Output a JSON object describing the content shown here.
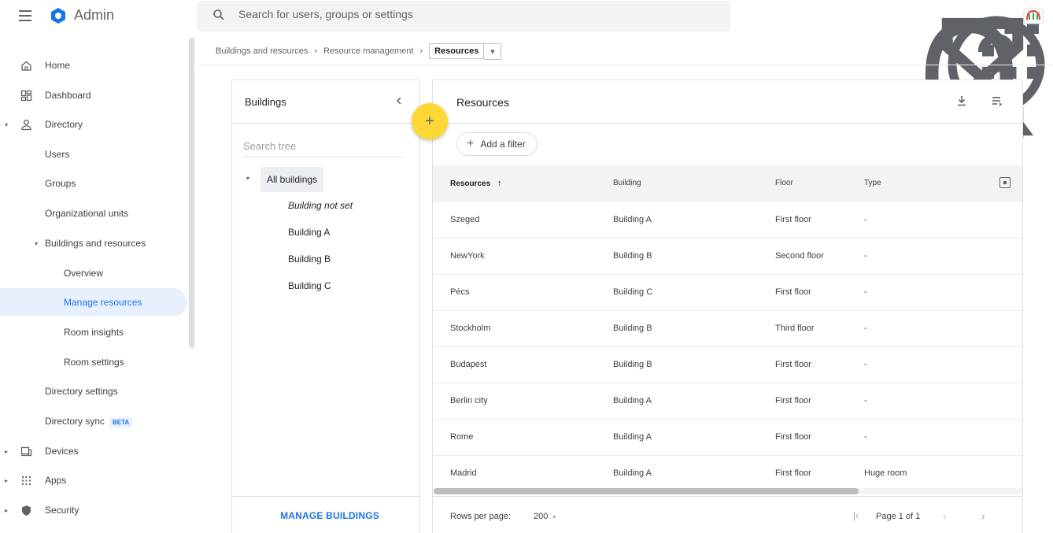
{
  "app": {
    "title": "Admin"
  },
  "search": {
    "placeholder": "Search for users, groups or settings"
  },
  "topbar_icons": [
    "bell-icon",
    "hourglass-icon",
    "help-icon",
    "apps-grid-icon",
    "avatar"
  ],
  "breadcrumb": {
    "items": [
      "Buildings and resources",
      "Resource management"
    ],
    "separator": "›",
    "current": "Resources",
    "dropdown": "▾"
  },
  "sidebar": {
    "items": [
      {
        "label": "Home",
        "icon": "home-icon"
      },
      {
        "label": "Dashboard",
        "icon": "dashboard-icon"
      },
      {
        "label": "Directory",
        "icon": "person-icon",
        "caret": "▾"
      },
      {
        "label": "Users"
      },
      {
        "label": "Groups"
      },
      {
        "label": "Organizational units"
      },
      {
        "label": "Buildings and resources",
        "caret": "▾"
      },
      {
        "label": "Overview"
      },
      {
        "label": "Manage resources",
        "active": true
      },
      {
        "label": "Room insights"
      },
      {
        "label": "Room settings"
      },
      {
        "label": "Directory settings"
      },
      {
        "label": "Directory sync",
        "badge": "BETA"
      },
      {
        "label": "Devices",
        "icon": "devices-icon",
        "caret": "▸"
      },
      {
        "label": "Apps",
        "icon": "apps-icon",
        "caret": "▸"
      },
      {
        "label": "Security",
        "icon": "shield-icon",
        "caret": "▸"
      }
    ]
  },
  "buildings_panel": {
    "title": "Buildings",
    "search_placeholder": "Search tree",
    "root": "All buildings",
    "root_caret": "▾",
    "children": [
      "Building not set",
      "Building A",
      "Building B",
      "Building C"
    ],
    "footer_button": "MANAGE BUILDINGS"
  },
  "fab": {
    "label": "+"
  },
  "resources_panel": {
    "title": "Resources",
    "filter_chip": {
      "icon": "+",
      "label": "Add a filter"
    },
    "columns": [
      "Resources",
      "Building",
      "Floor",
      "Type"
    ],
    "sort_indicator": "↑",
    "rows": [
      {
        "resource": "Szeged",
        "building": "Building A",
        "floor": "First floor",
        "type": "-"
      },
      {
        "resource": "NewYork",
        "building": "Building B",
        "floor": "Second floor",
        "type": "-"
      },
      {
        "resource": "Pécs",
        "building": "Building C",
        "floor": "First floor",
        "type": "-"
      },
      {
        "resource": "Stockholm",
        "building": "Building B",
        "floor": "Third floor",
        "type": "-"
      },
      {
        "resource": "Budapest",
        "building": "Building B",
        "floor": "First floor",
        "type": "-"
      },
      {
        "resource": "Berlin city",
        "building": "Building A",
        "floor": "First floor",
        "type": "-"
      },
      {
        "resource": "Rome",
        "building": "Building A",
        "floor": "First floor",
        "type": "-"
      },
      {
        "resource": "Madrid",
        "building": "Building A",
        "floor": "First floor",
        "type": "Huge room"
      }
    ],
    "footer": {
      "rows_label": "Rows per page:",
      "rows_value": "200",
      "rows_caret": "▾",
      "first_page": "|‹",
      "page_text": "Page 1 of 1",
      "prev": "‹",
      "next": "›"
    }
  },
  "colors": {
    "accent": "#1a73e8",
    "fab": "#fdd835",
    "active_bg": "#e8f0fe"
  }
}
